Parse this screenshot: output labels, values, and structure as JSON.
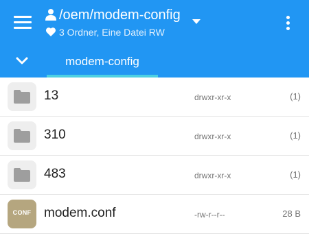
{
  "header": {
    "path": "/oem/modem-config",
    "subtitle": "3 Ordner, Eine Datei RW"
  },
  "tabs": [
    {
      "label": "modem-config",
      "active": true
    }
  ],
  "files": [
    {
      "name": "13",
      "permissions": "drwxr-xr-x",
      "size": "(1)",
      "type": "folder"
    },
    {
      "name": "310",
      "permissions": "drwxr-xr-x",
      "size": "(1)",
      "type": "folder"
    },
    {
      "name": "483",
      "permissions": "drwxr-xr-x",
      "size": "(1)",
      "type": "folder"
    },
    {
      "name": "modem.conf",
      "permissions": "-rw-r--r--",
      "size": "28 B",
      "type": "file",
      "icon_label": "CONF"
    }
  ],
  "colors": {
    "appbar": "#2196f3",
    "tab_indicator": "#4dd0e1",
    "file_icon": "#b5a67f"
  }
}
